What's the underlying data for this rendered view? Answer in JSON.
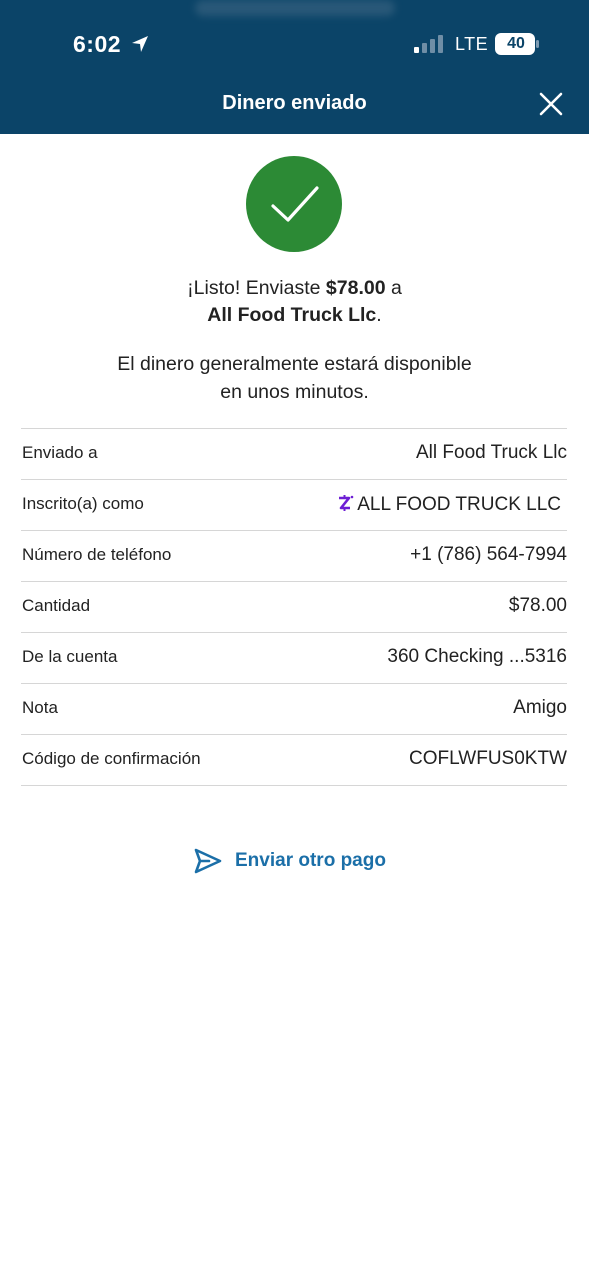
{
  "status_bar": {
    "time": "6:02",
    "network": "LTE",
    "battery": "40"
  },
  "header": {
    "title": "Dinero enviado"
  },
  "confirmation": {
    "prefix": "¡Listo! Enviaste ",
    "amount": "$78.00",
    "middle": " a",
    "recipient": "All Food Truck Llc",
    "suffix": ".",
    "note_line1": "El dinero generalmente estará disponible",
    "note_line2": "en unos minutos."
  },
  "details": [
    {
      "label": "Enviado a",
      "value": "All Food Truck Llc"
    },
    {
      "label": "Inscrito(a) como",
      "value": "ALL FOOD TRUCK LLC",
      "icon": "zelle-icon"
    },
    {
      "label": "Número de teléfono",
      "value": "+1 (786) 564-7994"
    },
    {
      "label": "Cantidad",
      "value": "$78.00"
    },
    {
      "label": "De la cuenta",
      "value": "360 Checking ...5316"
    },
    {
      "label": "Nota",
      "value": "Amigo"
    },
    {
      "label": "Código de confirmación",
      "value": "COFLWFUS0KTW"
    }
  ],
  "actions": {
    "send_again": "Enviar otro pago"
  },
  "colors": {
    "header": "#0b4468",
    "success": "#2c8a35",
    "link": "#1b6fa8",
    "zelle": "#6d1ed4"
  }
}
